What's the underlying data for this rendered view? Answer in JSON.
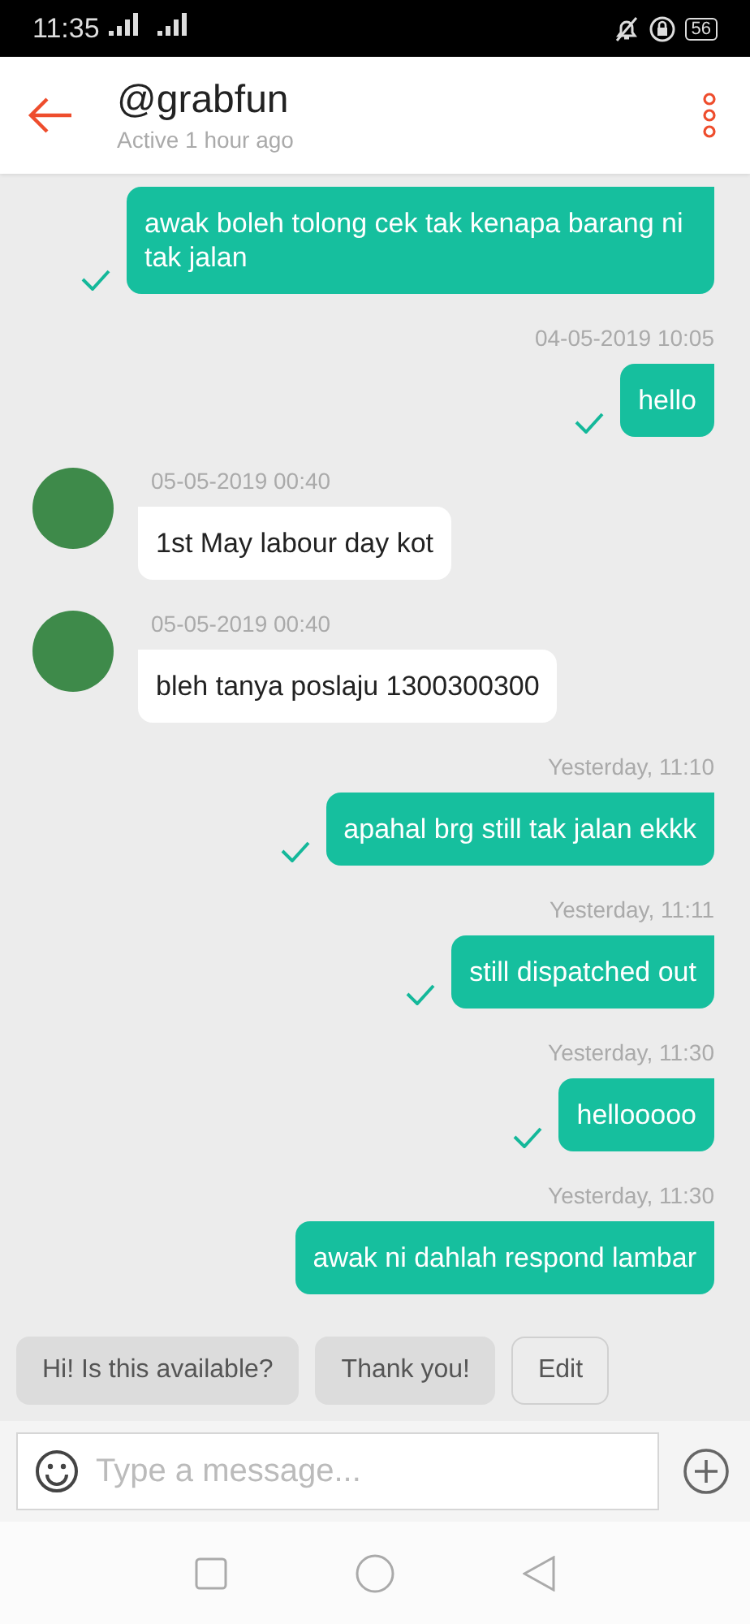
{
  "status_bar": {
    "time": "11:35",
    "battery": "56"
  },
  "header": {
    "title": "@grabfun",
    "subtitle": "Active 1 hour ago"
  },
  "messages": [
    {
      "kind": "outgoing",
      "text": "awak boleh tolong cek tak kenapa barang ni tak jalan",
      "ticked": true
    },
    {
      "kind": "outgoing",
      "timestamp": "04-05-2019 10:05",
      "text": "hello",
      "ticked": true
    },
    {
      "kind": "incoming",
      "timestamp": "05-05-2019 00:40",
      "text": "1st May labour day kot"
    },
    {
      "kind": "incoming",
      "timestamp": "05-05-2019 00:40",
      "text": "bleh tanya poslaju 1300300300"
    },
    {
      "kind": "outgoing",
      "timestamp": "Yesterday, 11:10",
      "text": "apahal brg still tak jalan ekkk",
      "ticked": true
    },
    {
      "kind": "outgoing",
      "timestamp": "Yesterday, 11:11",
      "text": "still dispatched out",
      "ticked": true
    },
    {
      "kind": "outgoing",
      "timestamp": "Yesterday, 11:30",
      "text": "hellooooo",
      "ticked": true
    },
    {
      "kind": "outgoing",
      "timestamp": "Yesterday, 11:30",
      "text": "awak ni dahlah respond lambar"
    }
  ],
  "quick_replies": [
    {
      "kind": "reply",
      "label": "Hi! Is this available?"
    },
    {
      "kind": "reply",
      "label": "Thank you!"
    },
    {
      "kind": "edit",
      "label": "Edit"
    }
  ],
  "composer": {
    "placeholder": "Type a message..."
  }
}
